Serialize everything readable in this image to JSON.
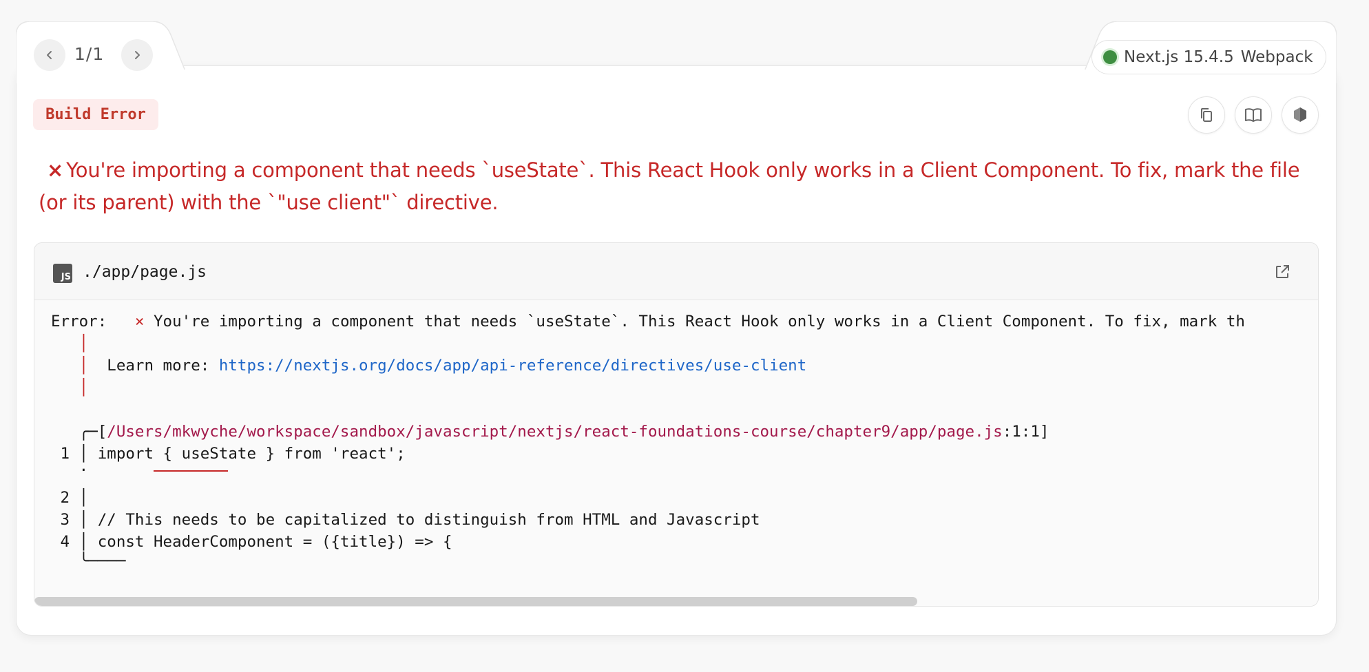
{
  "pager": {
    "text": "1/1"
  },
  "version": {
    "label": "Next.js 15.4.5",
    "bundler": "Webpack",
    "status_color": "#3e8e41"
  },
  "badge": {
    "label": "Build Error"
  },
  "toolbar": {
    "copy_icon": "copy-icon",
    "docs_icon": "book-icon",
    "node_icon": "hexagon-icon"
  },
  "error": {
    "mark": "×",
    "message": "You're importing a component that needs `useState`. This React Hook only works in a Client Component. To fix, mark the file (or its parent) with the `\"use client\"` directive."
  },
  "code_frame": {
    "file_badge": "JS",
    "file_path": "./app/page.js",
    "error_prefix": "Error:",
    "error_mark": "×",
    "error_line": "You're importing a component that needs `useState`. This React Hook only works in a Client Component. To fix, mark th",
    "learn_more_label": "Learn more: ",
    "learn_more_url": "https://nextjs.org/docs/app/api-reference/directives/use-client",
    "location_path": "/Users/mkwyche/workspace/sandbox/javascript/nextjs/react-foundations-course/chapter9/app/page.js",
    "location_pos": ":1:1]",
    "lines": [
      {
        "num": "1",
        "code": "import { useState } from 'react';"
      },
      {
        "num": "2",
        "code": ""
      },
      {
        "num": "3",
        "code": "// This needs to be capitalized to distinguish from HTML and Javascript"
      },
      {
        "num": "4",
        "code": "const HeaderComponent = ({title}) => {"
      }
    ]
  },
  "colors": {
    "error": "#c62828",
    "link": "#1e66c8",
    "path": "#a3194b"
  }
}
